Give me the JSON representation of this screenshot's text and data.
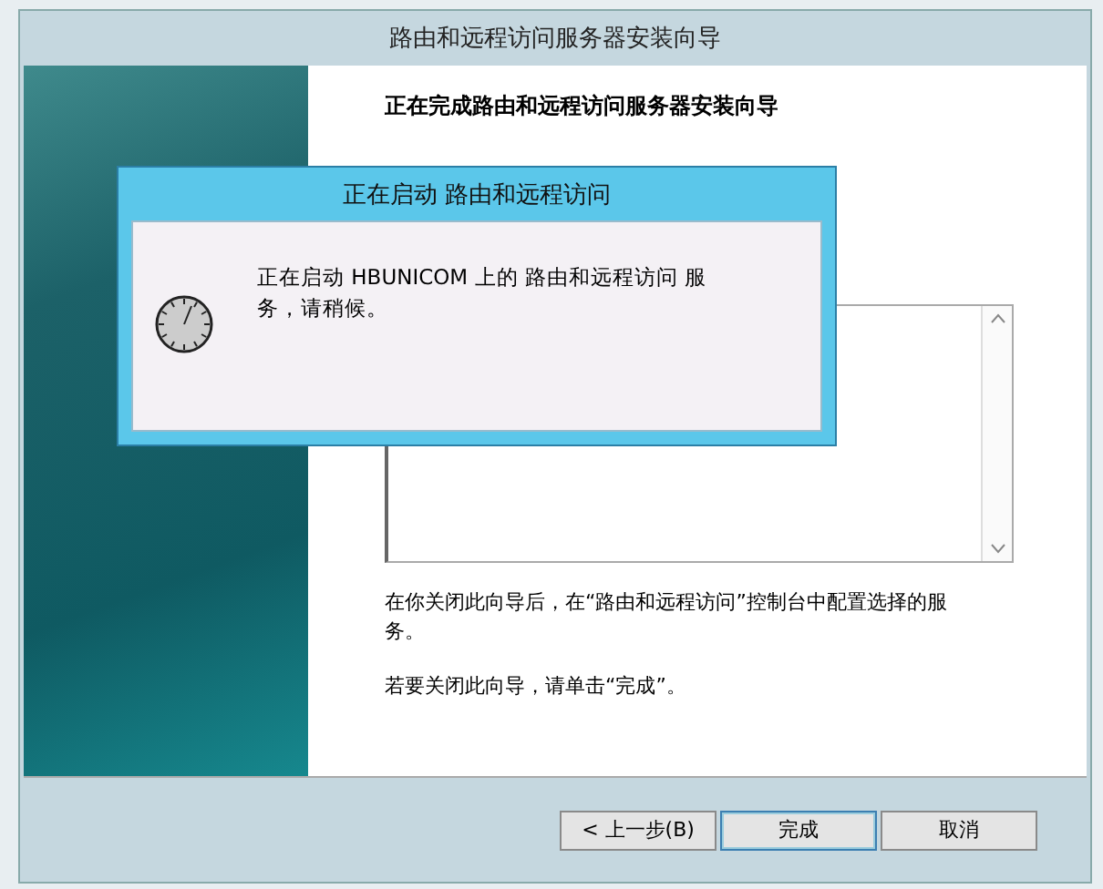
{
  "wizard": {
    "title": "路由和远程访问服务器安装向导",
    "heading": "正在完成路由和远程访问服务器安装向导",
    "paragraphs": [
      "在你关闭此向导后，在“路由和远程访问”控制台中配置选择的服务。",
      "若要关闭此向导，请单击“完成”。"
    ],
    "buttons": [
      {
        "label": "< 上一步(B)",
        "kind": "normal"
      },
      {
        "label": "完成",
        "kind": "default"
      },
      {
        "label": "取消",
        "kind": "normal"
      }
    ]
  },
  "dialog": {
    "title": "正在启动 路由和远程访问",
    "message": "正在启动 HBUNICOM 上的 路由和远程访问 服务，请稍候。"
  }
}
